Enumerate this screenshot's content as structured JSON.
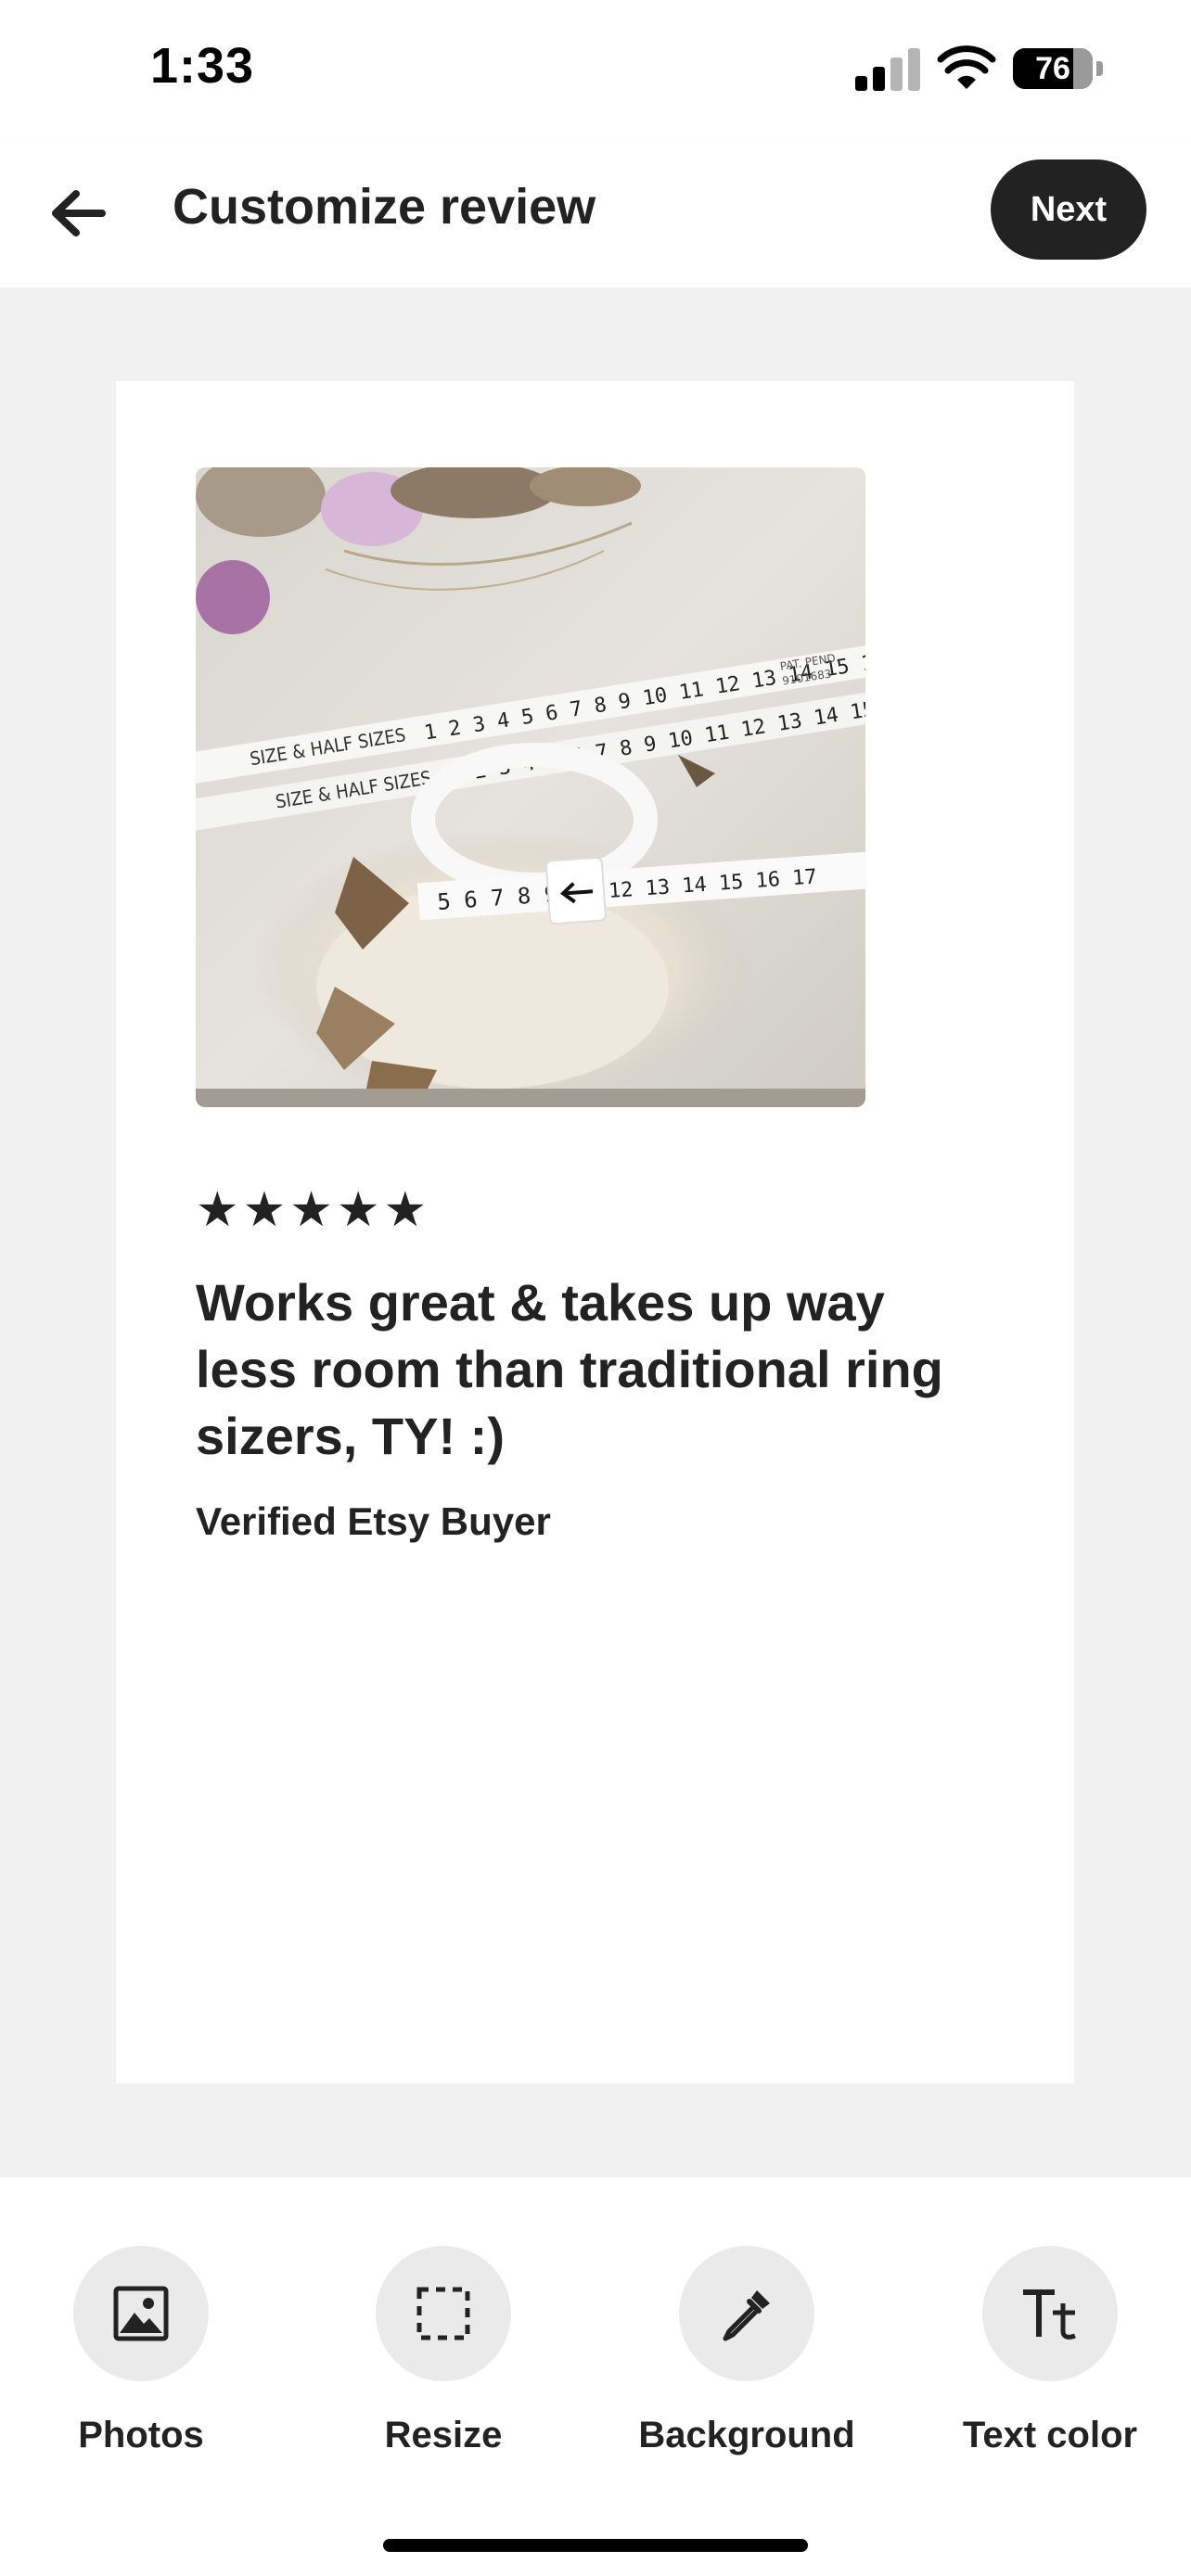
{
  "status_bar": {
    "time": "1:33",
    "battery": "76"
  },
  "header": {
    "title": "Customize review",
    "next_label": "Next"
  },
  "review": {
    "rating": 5,
    "stars": [
      "★",
      "★",
      "★",
      "★",
      "★"
    ],
    "text": "Works great & takes up way less room than traditional ring sizers, TY! :)",
    "reviewer": "Verified Etsy Buyer",
    "photo_text": {
      "ruler_label": "SIZE & HALF SIZES",
      "ruler_numbers": "1 2 3 4 5 6 7 8 9 10 11 12 13 14 15 16 17",
      "patent_label": "PAT. PEND.",
      "patent_number": "9101683"
    }
  },
  "toolbar": {
    "items": [
      {
        "label": "Photos",
        "icon": "photo-icon"
      },
      {
        "label": "Resize",
        "icon": "resize-icon"
      },
      {
        "label": "Background",
        "icon": "eyedropper-icon"
      },
      {
        "label": "Text color",
        "icon": "text-color-icon"
      }
    ]
  },
  "colors": {
    "dark": "#222222",
    "canvas_bg": "#f1f1f1",
    "card_bg": "#ffffff",
    "tool_circle_bg": "#eaeaea"
  }
}
